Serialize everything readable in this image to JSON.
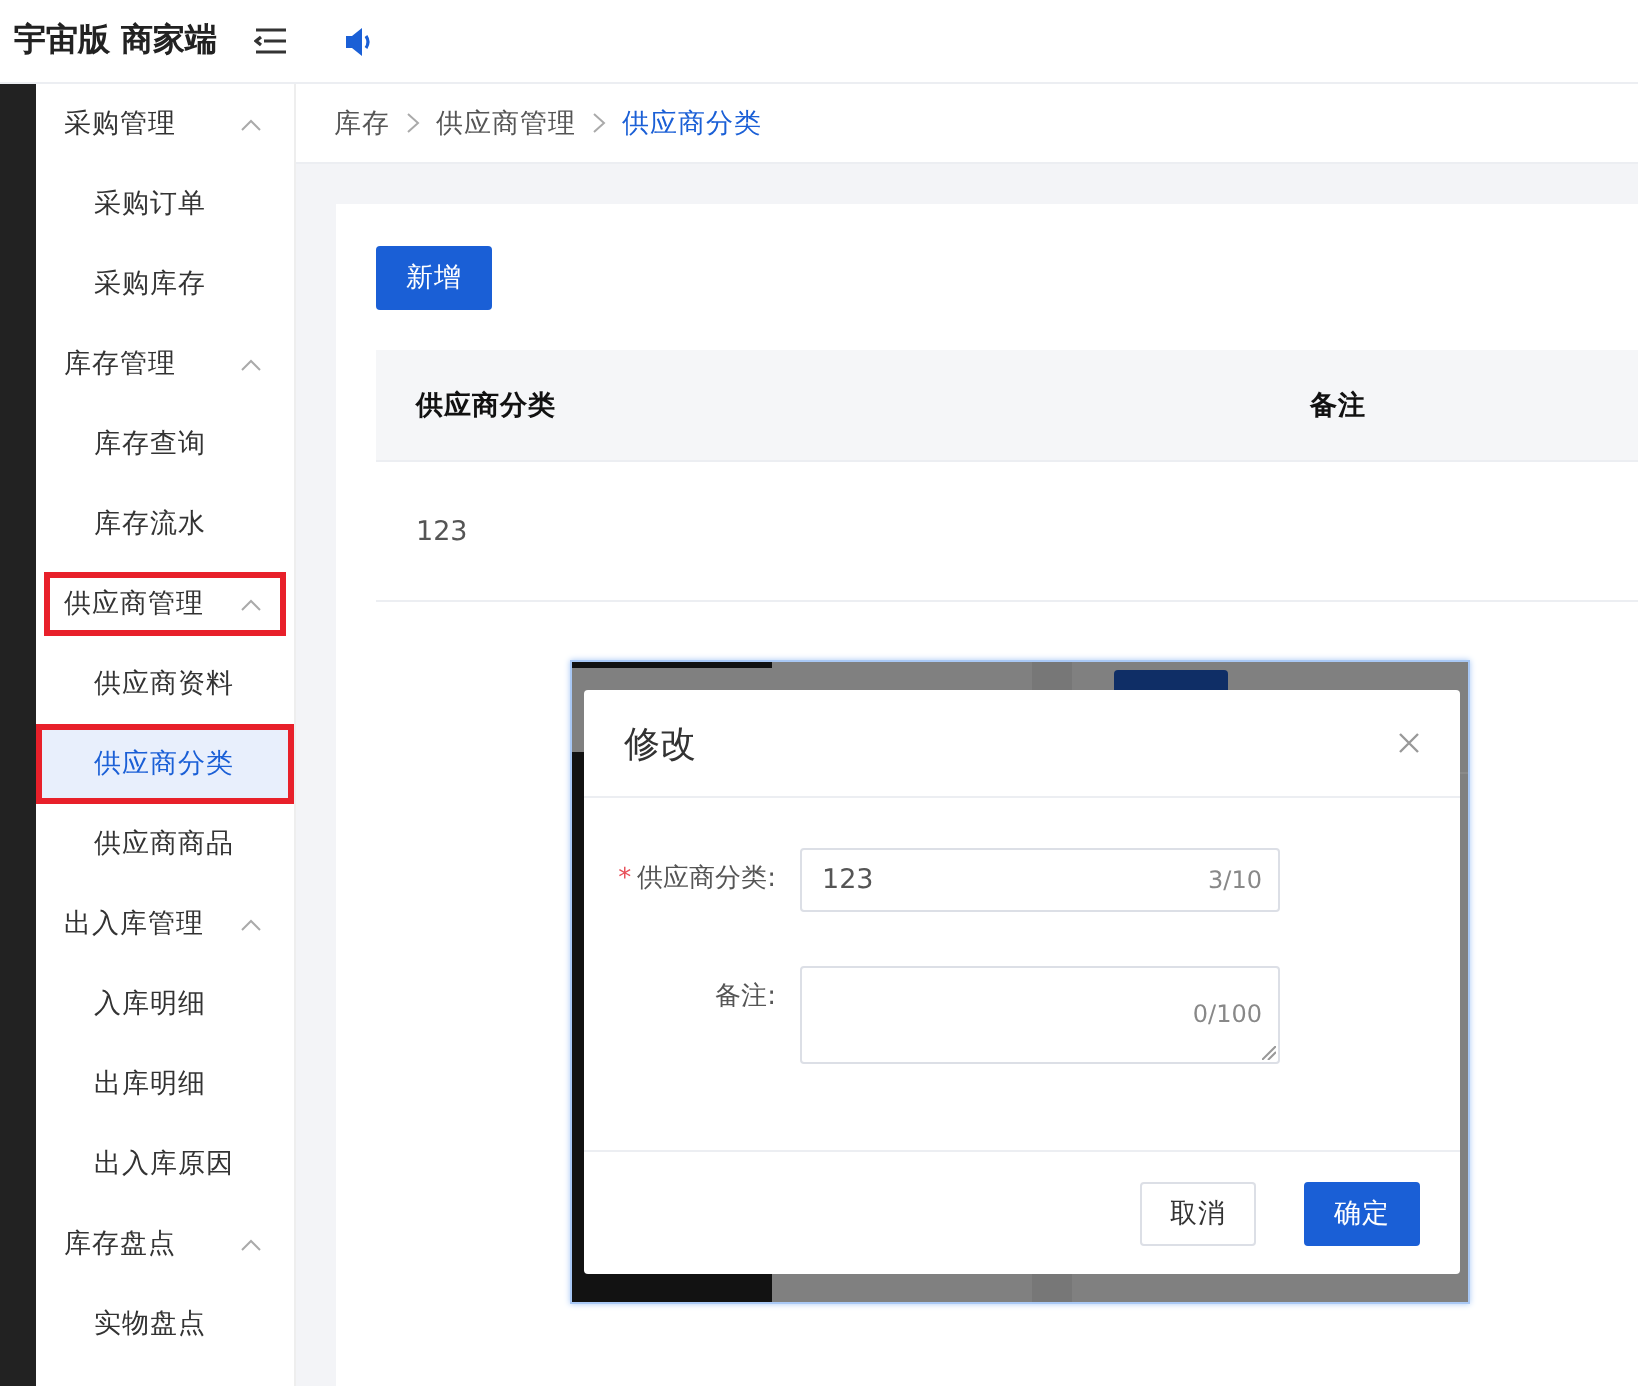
{
  "header": {
    "title": "宇宙版 商家端"
  },
  "sidebar": {
    "groups": [
      {
        "label": "采购管理",
        "expanded": true,
        "highlighted": false,
        "items": [
          {
            "label": "采购订单",
            "selected": false,
            "highlighted": false
          },
          {
            "label": "采购库存",
            "selected": false,
            "highlighted": false
          }
        ]
      },
      {
        "label": "库存管理",
        "expanded": true,
        "highlighted": false,
        "items": [
          {
            "label": "库存查询",
            "selected": false,
            "highlighted": false
          },
          {
            "label": "库存流水",
            "selected": false,
            "highlighted": false
          }
        ]
      },
      {
        "label": "供应商管理",
        "expanded": true,
        "highlighted": true,
        "items": [
          {
            "label": "供应商资料",
            "selected": false,
            "highlighted": false
          },
          {
            "label": "供应商分类",
            "selected": true,
            "highlighted": true
          },
          {
            "label": "供应商商品",
            "selected": false,
            "highlighted": false
          }
        ]
      },
      {
        "label": "出入库管理",
        "expanded": true,
        "highlighted": false,
        "items": [
          {
            "label": "入库明细",
            "selected": false,
            "highlighted": false
          },
          {
            "label": "出库明细",
            "selected": false,
            "highlighted": false
          },
          {
            "label": "出入库原因",
            "selected": false,
            "highlighted": false
          }
        ]
      },
      {
        "label": "库存盘点",
        "expanded": true,
        "highlighted": false,
        "items": [
          {
            "label": "实物盘点",
            "selected": false,
            "highlighted": false
          }
        ]
      }
    ]
  },
  "breadcrumb": [
    "库存",
    "供应商管理",
    "供应商分类"
  ],
  "toolbar": {
    "add_button": "新增"
  },
  "table": {
    "columns": [
      "供应商分类",
      "备注"
    ],
    "rows": [
      [
        "123"
      ]
    ]
  },
  "dialog": {
    "title": "修改",
    "fields": [
      {
        "kind": "input",
        "marker": "*",
        "label": "供应商分类:",
        "value": "123",
        "count": "3/10"
      },
      {
        "kind": "textarea",
        "label": "备注:",
        "count": "0/100"
      }
    ],
    "buttons": [
      {
        "label": "取消",
        "primary": false
      },
      {
        "label": "确定",
        "primary": true
      }
    ]
  }
}
